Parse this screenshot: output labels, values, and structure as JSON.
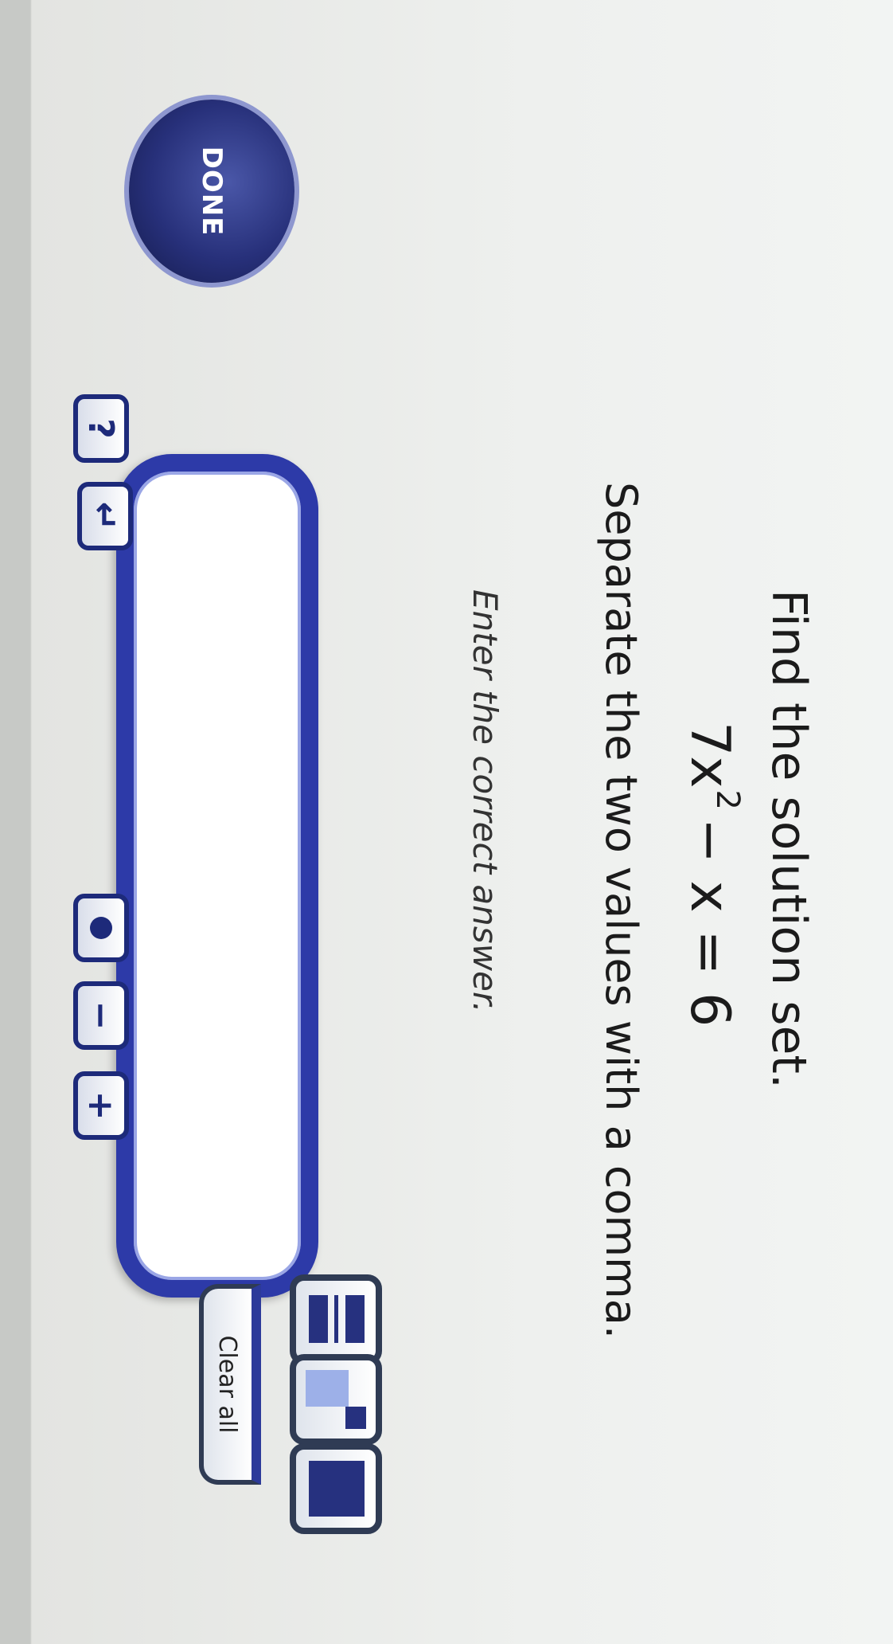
{
  "question": {
    "title": "Find the solution set.",
    "equation_base": "7x",
    "equation_exponent": "2",
    "equation_rest": "− x = 6",
    "instruction": "Separate the two values with a comma.",
    "prompt": "Enter the correct answer."
  },
  "answer": {
    "value": ""
  },
  "keypad": {
    "plus": "+",
    "minus": "−",
    "enter": "↵",
    "help": "?"
  },
  "math_tools": {
    "clear_all_label": "Clear all"
  },
  "done_label": "DONE"
}
